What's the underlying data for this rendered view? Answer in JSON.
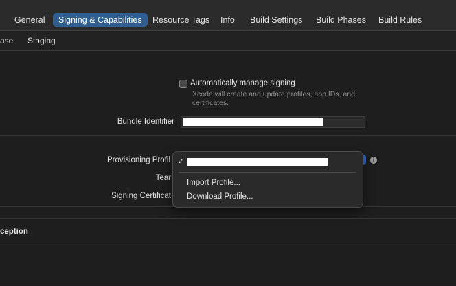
{
  "tabs": [
    {
      "label": "General"
    },
    {
      "label": "Signing & Capabilities"
    },
    {
      "label": "Resource Tags"
    },
    {
      "label": "Info"
    },
    {
      "label": "Build Settings"
    },
    {
      "label": "Build Phases"
    },
    {
      "label": "Build Rules"
    }
  ],
  "configs": [
    {
      "label": "ase"
    },
    {
      "label": "Staging"
    }
  ],
  "signing": {
    "auto_manage_label": "Automatically manage signing",
    "auto_manage_checked": false,
    "auto_manage_help": "Xcode will create and update profiles, app IDs, and certificates.",
    "bundle_identifier_label": "Bundle Identifier",
    "provisioning_profile_label": "Provisioning Profil",
    "team_label": "Tear",
    "signing_certificate_label": "Signing Certificat"
  },
  "menu": {
    "import_profile": "Import Profile...",
    "download_profile": "Download Profile..."
  },
  "section": {
    "title": "ception"
  },
  "icons": {
    "check": "✓",
    "info": "i"
  }
}
